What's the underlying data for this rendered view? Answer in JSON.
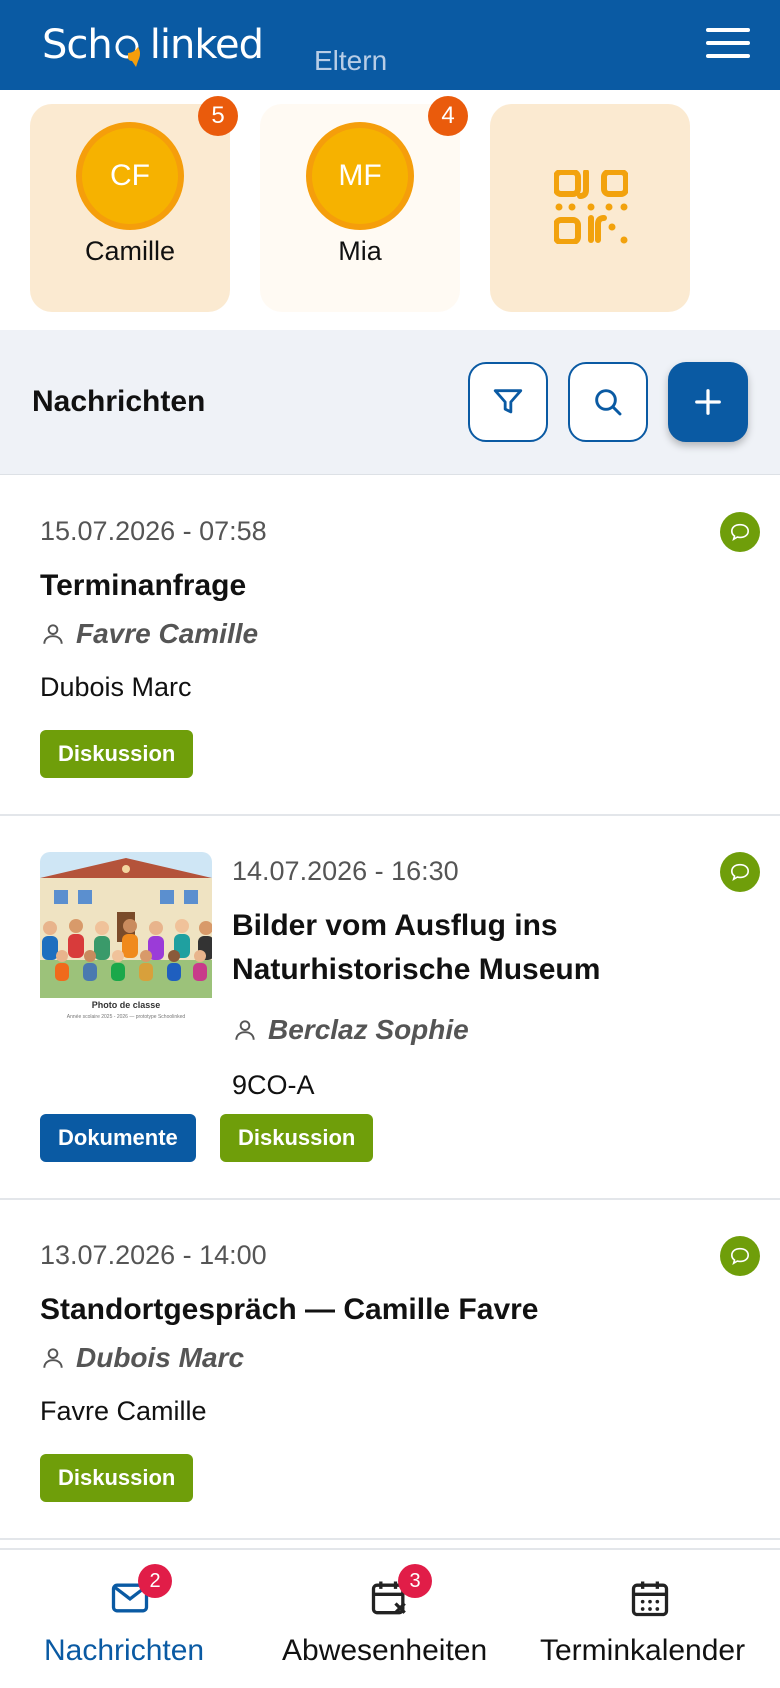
{
  "header": {
    "logo_text_left": "Sch",
    "logo_text_right": "linked",
    "role": "Eltern",
    "colors": {
      "brand": "#0a5aa3",
      "accent": "#f59e0b"
    }
  },
  "children": [
    {
      "initials": "CF",
      "name": "Camille",
      "badge": "5",
      "active": true
    },
    {
      "initials": "MF",
      "name": "Mia",
      "badge": "4",
      "active": false
    }
  ],
  "qr_icon": "qr-code-icon",
  "toolbar": {
    "title": "Nachrichten"
  },
  "messages": [
    {
      "date": "15.07.2026 - 07:58",
      "title": "Terminanfrage",
      "author": "Favre Camille",
      "meta": "Dubois Marc",
      "tags": [
        "Diskussion"
      ]
    },
    {
      "date": "14.07.2026 - 16:30",
      "title": "Bilder vom Ausflug ins Naturhistorische Museum",
      "author": "Berclaz Sophie",
      "meta": "9CO-A",
      "thumb_caption": "Photo de classe",
      "thumb_sub": "Année scolaire 2025 - 2026 — prototype Schoolinked",
      "tags": [
        "Dokumente",
        "Diskussion"
      ]
    },
    {
      "date": "13.07.2026 - 14:00",
      "title": "Standortgespräch — Camille Favre",
      "author": "Dubois Marc",
      "meta": "Favre Camille",
      "tags": [
        "Diskussion"
      ]
    }
  ],
  "bottom_nav": [
    {
      "label": "Nachrichten",
      "badge": "2",
      "active": true,
      "icon": "mail-icon"
    },
    {
      "label": "Abwesenheiten",
      "badge": "3",
      "active": false,
      "icon": "calendar-x-icon"
    },
    {
      "label": "Terminkalender",
      "badge": "",
      "active": false,
      "icon": "calendar-icon"
    }
  ]
}
